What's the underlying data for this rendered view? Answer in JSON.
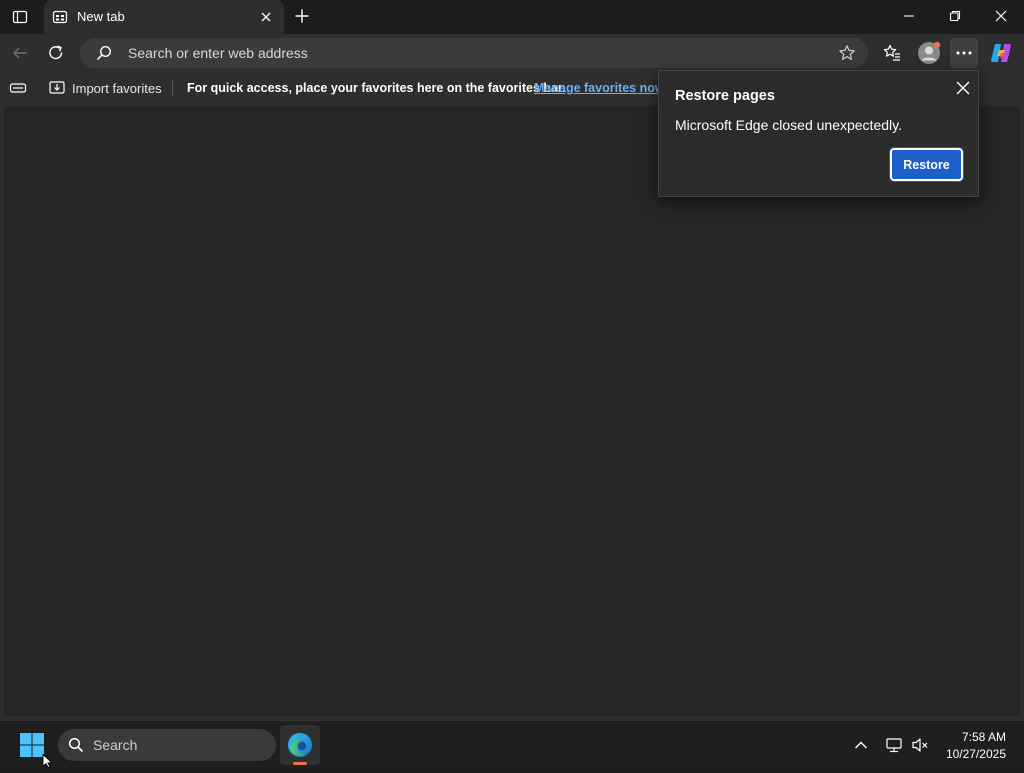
{
  "browser": {
    "tab": {
      "title": "New tab",
      "icon": "new-tab-page-icon"
    },
    "address_bar": {
      "placeholder": "Search or enter web address"
    },
    "favorites_bar": {
      "import_label": "Import favorites",
      "message": "For quick access, place your favorites here on the favorites bar.",
      "manage_link": "Manage favorites now"
    },
    "colors": {
      "accent": "#1e5ec8",
      "link": "#6ab0f3",
      "background": "#1c1c1c",
      "content": "#252525"
    }
  },
  "restore_popup": {
    "title": "Restore pages",
    "message": "Microsoft Edge closed unexpectedly.",
    "button_label": "Restore"
  },
  "taskbar": {
    "search_label": "Search",
    "apps": [
      "windows-start-icon",
      "edge-icon"
    ],
    "clock": {
      "time": "7:58 AM",
      "date": "10/27/2025"
    }
  }
}
